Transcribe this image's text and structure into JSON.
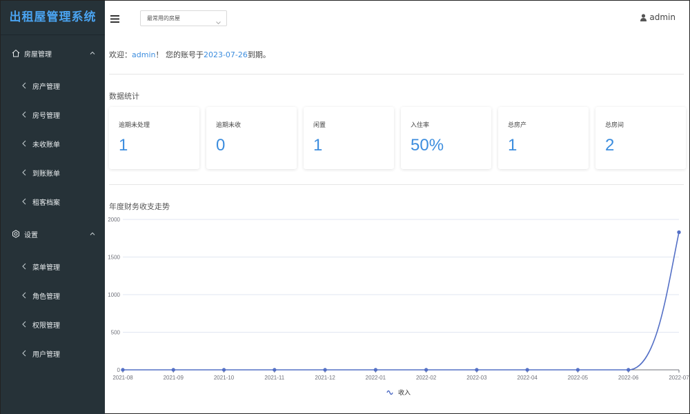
{
  "sidebar": {
    "brand": "出租屋管理系统",
    "groups": [
      {
        "label": "房屋管理",
        "items": [
          {
            "label": "房产管理"
          },
          {
            "label": "房号管理"
          },
          {
            "label": "未收账单"
          },
          {
            "label": "到账账单"
          },
          {
            "label": "租客档案"
          }
        ]
      },
      {
        "label": "设置",
        "items": [
          {
            "label": "菜单管理"
          },
          {
            "label": "角色管理"
          },
          {
            "label": "权限管理"
          },
          {
            "label": "用户管理"
          }
        ]
      }
    ]
  },
  "header": {
    "select_value": "最常用的房屋",
    "username": "admin"
  },
  "welcome": {
    "prefix": "欢迎：",
    "user": "admin",
    "middle": "！ 您的账号于",
    "date": "2023-07-26",
    "suffix": "到期。"
  },
  "stats": {
    "title": "数据统计",
    "cards": [
      {
        "label": "逾期未处理",
        "value": "1"
      },
      {
        "label": "逾期未收",
        "value": "0"
      },
      {
        "label": "闲置",
        "value": "1"
      },
      {
        "label": "入住率",
        "value": "50%"
      },
      {
        "label": "总房产",
        "value": "1"
      },
      {
        "label": "总房间",
        "value": "2"
      }
    ]
  },
  "chart_data": {
    "type": "line",
    "title": "年度财务收支走势",
    "x": [
      "2021-08",
      "2021-09",
      "2021-10",
      "2021-11",
      "2021-12",
      "2022-01",
      "2022-02",
      "2022-03",
      "2022-04",
      "2022-05",
      "2022-06",
      "2022-07"
    ],
    "series": [
      {
        "name": "收入",
        "values": [
          0,
          0,
          0,
          0,
          0,
          0,
          0,
          0,
          0,
          0,
          0,
          1830
        ]
      }
    ],
    "ylim": [
      0,
      2000
    ],
    "yticks": [
      0,
      500,
      1000,
      1500,
      2000
    ],
    "grid": true,
    "legend": "bottom-center",
    "color": "#5470c6"
  },
  "colors": {
    "accent": "#3c8dde",
    "sidebar_bg": "#263238",
    "brand": "#4aa3f0"
  }
}
